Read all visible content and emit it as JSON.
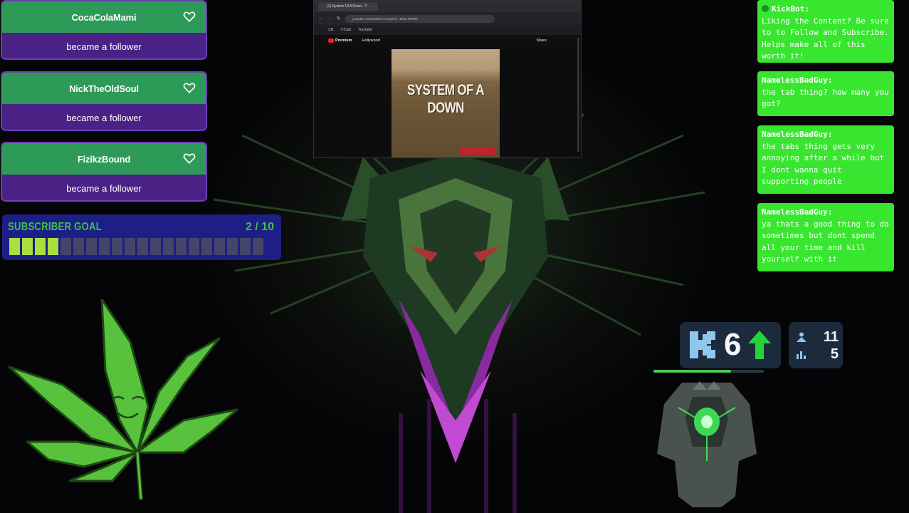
{
  "alerts": [
    {
      "username": "CocaColaMami",
      "action": "became a follower"
    },
    {
      "username": "NickTheOldSoul",
      "action": "became a follower"
    },
    {
      "username": "FizikzBound",
      "action": "became a follower"
    }
  ],
  "subscriber_goal": {
    "label": "SUBSCRIBER GOAL",
    "current": 2,
    "target": 10,
    "display": "2 / 10"
  },
  "browser": {
    "tab_title": "(1) System Of A Down - T",
    "url": "youtube.com/watch?v=mL32A0...&list=RDMM",
    "bookmarks": [
      "3.B",
      "T-Club",
      "YouTube"
    ],
    "site": "Premium",
    "channel": "Hollywood",
    "album_text": "SYSTEM OF A DOWN",
    "action_label": "Share"
  },
  "chat": [
    {
      "user": "KickBot:",
      "message": "Liking the Content? Be sure to to Follow and Subscribe. Helps make all of this worth it!"
    },
    {
      "user": "NamelessBadGuy:",
      "message": "the tab thing? how many you got?"
    },
    {
      "user": "NamelessBadGuy:",
      "message": "the tabs thing gets very annoying after a while but I dont wanna quit supporting people"
    },
    {
      "user": "NamelessBadGuy:",
      "message": "ya thats a good thing to do sometimes but dont spend all your time and kill yourself with it"
    }
  ],
  "kick_widget": {
    "logo_icon": "kick-logo-icon",
    "level": "6",
    "followers": "11",
    "viewers": "5",
    "trend_icon": "up-arrow-icon",
    "progress": 0.7
  },
  "colors": {
    "alert_top": "#2e9a58",
    "alert_bottom": "#4a2185",
    "goal_bg": "#1d1f86",
    "goal_fill": "#a9df3e",
    "chat_bg": "#38e62f",
    "kick_green": "#53fc18"
  }
}
